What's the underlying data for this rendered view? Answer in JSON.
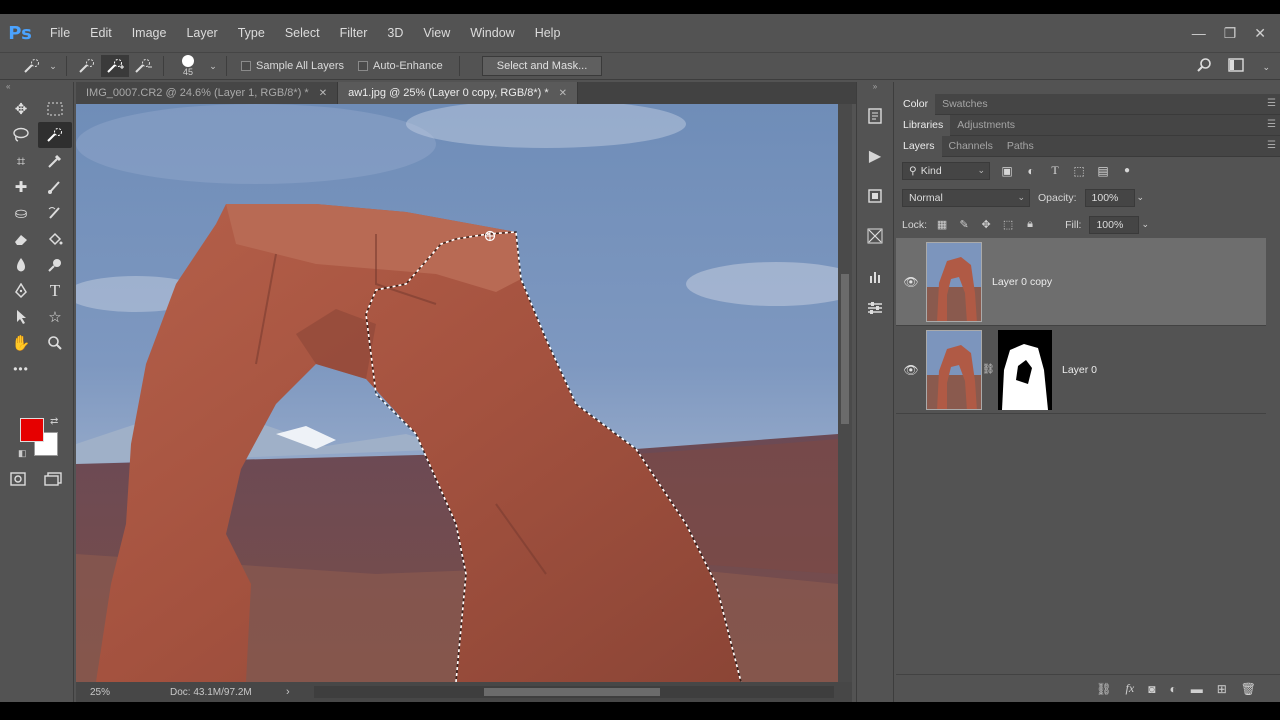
{
  "app": {
    "logo": "Ps"
  },
  "menu": [
    "File",
    "Edit",
    "Image",
    "Layer",
    "Type",
    "Select",
    "Filter",
    "3D",
    "View",
    "Window",
    "Help"
  ],
  "window_controls": {
    "minimize": "—",
    "restore": "❐",
    "close": "✕"
  },
  "options": {
    "brush_size": "45",
    "sample_all_layers": "Sample All Layers",
    "auto_enhance": "Auto-Enhance",
    "select_and_mask": "Select and Mask..."
  },
  "tabs": [
    {
      "label": "IMG_0007.CR2 @ 24.6% (Layer 1, RGB/8*) *",
      "active": false
    },
    {
      "label": "aw1.jpg @ 25% (Layer 0 copy, RGB/8*) *",
      "active": true
    }
  ],
  "status": {
    "zoom": "25%",
    "doc": "Doc: 43.1M/97.2M"
  },
  "colors": {
    "foreground": "#e60000",
    "background": "#ffffff"
  },
  "panels": {
    "group1": [
      "Color",
      "Swatches"
    ],
    "group2": [
      "Libraries",
      "Adjustments"
    ],
    "group3": [
      "Layers",
      "Channels",
      "Paths"
    ]
  },
  "layers_panel": {
    "kind": "Kind",
    "blend_mode": "Normal",
    "opacity_label": "Opacity:",
    "opacity": "100%",
    "lock_label": "Lock:",
    "fill_label": "Fill:",
    "fill": "100%",
    "layers": [
      {
        "name": "Layer 0 copy",
        "selected": true
      },
      {
        "name": "Layer 0",
        "selected": false
      }
    ]
  }
}
